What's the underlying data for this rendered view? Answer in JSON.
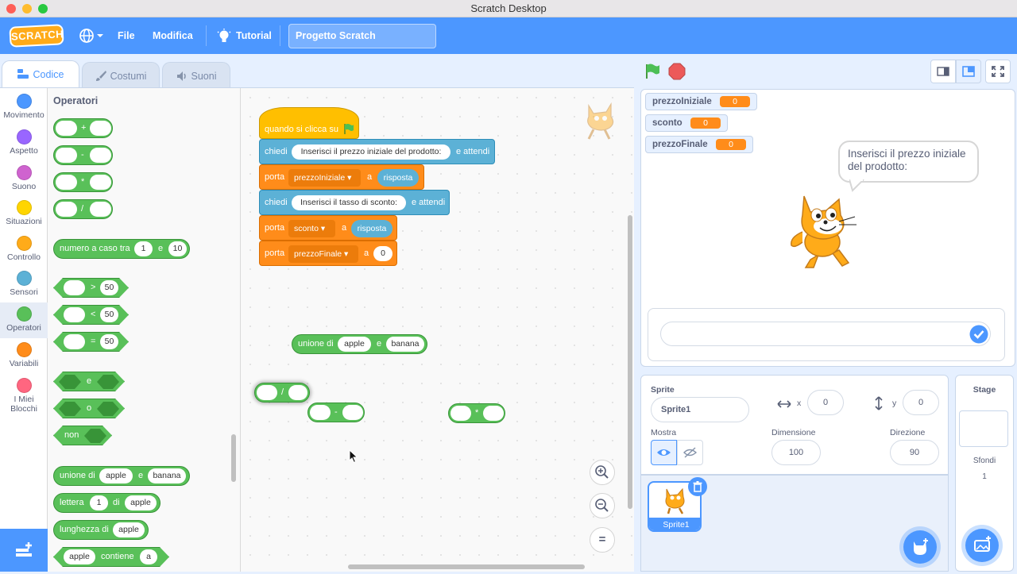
{
  "window": {
    "title": "Scratch Desktop"
  },
  "menubar": {
    "logo": "SCRATCH",
    "file": "File",
    "edit": "Modifica",
    "tutorial": "Tutorial",
    "project_title": "Progetto Scratch"
  },
  "tabs": {
    "code": "Codice",
    "costumes": "Costumi",
    "sounds": "Suoni"
  },
  "categories": [
    {
      "label": "Movimento",
      "color": "#4c97ff"
    },
    {
      "label": "Aspetto",
      "color": "#9966ff"
    },
    {
      "label": "Suono",
      "color": "#cf63cf"
    },
    {
      "label": "Situazioni",
      "color": "#ffd500"
    },
    {
      "label": "Controllo",
      "color": "#ffab19"
    },
    {
      "label": "Sensori",
      "color": "#5cb1d6"
    },
    {
      "label": "Operatori",
      "color": "#59c059"
    },
    {
      "label": "Variabili",
      "color": "#ff8c1a"
    },
    {
      "label": "I Miei Blocchi",
      "color": "#ff6680"
    }
  ],
  "palette": {
    "heading": "Operatori",
    "add": "+",
    "sub": "-",
    "mul": "*",
    "div": "/",
    "random": {
      "text": "numero a caso tra",
      "from": "1",
      "and": "e",
      "to": "10"
    },
    "gt": ">",
    "lt": "<",
    "eq": "=",
    "cmp_value": "50",
    "and": "e",
    "or": "o",
    "not": "non",
    "join": {
      "text": "unione di",
      "a": "apple",
      "and": "e",
      "b": "banana"
    },
    "letter": {
      "text": "lettera",
      "n": "1",
      "of": "di",
      "word": "apple"
    },
    "length": {
      "text": "lunghezza di",
      "word": "apple"
    },
    "contains": {
      "word": "apple",
      "text": "contiene",
      "letter": "a"
    }
  },
  "script": {
    "hat": "quando si clicca su",
    "ask1": {
      "cmd": "chiedi",
      "text": "Inserisci il prezzo iniziale del prodotto:",
      "tail": "e attendi"
    },
    "set1": {
      "cmd": "porta",
      "var": "prezzoIniziale",
      "to": "a",
      "value": "risposta"
    },
    "ask2": {
      "cmd": "chiedi",
      "text": "Inserisci il tasso di sconto:",
      "tail": "e attendi"
    },
    "set2": {
      "cmd": "porta",
      "var": "sconto",
      "to": "a",
      "value": "risposta"
    },
    "set3": {
      "cmd": "porta",
      "var": "prezzoFinale",
      "to": "a",
      "value": "0"
    }
  },
  "loose": {
    "join": {
      "text": "unione di",
      "a": "apple",
      "and": "e",
      "b": "banana"
    },
    "div": "/",
    "sub": "-",
    "mul": "*"
  },
  "zoom": {
    "reset": "="
  },
  "monitors": [
    {
      "name": "prezzoIniziale",
      "value": "0"
    },
    {
      "name": "sconto",
      "value": "0"
    },
    {
      "name": "prezzoFinale",
      "value": "0"
    }
  ],
  "speech": "Inserisci il prezzo iniziale del prodotto:",
  "sprite_info": {
    "sprite_label": "Sprite",
    "sprite_name": "Sprite1",
    "x_label": "x",
    "x": "0",
    "y_label": "y",
    "y": "0",
    "show_label": "Mostra",
    "size_label": "Dimensione",
    "size": "100",
    "dir_label": "Direzione",
    "direction": "90"
  },
  "sprites": [
    {
      "name": "Sprite1"
    }
  ],
  "stage_panel": {
    "title": "Stage",
    "backdrops_label": "Sfondi",
    "backdrops_count": "1"
  }
}
